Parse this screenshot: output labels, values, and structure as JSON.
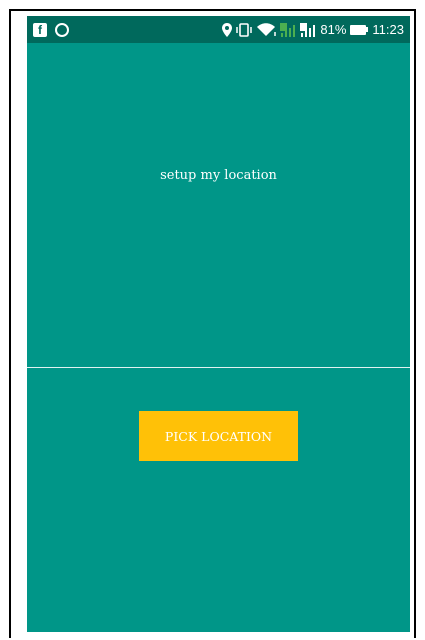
{
  "status_bar": {
    "battery_percent": "81%",
    "time": "11:23",
    "icons": [
      "facebook-icon",
      "whatsapp-icon",
      "location-icon",
      "vibrate-icon",
      "wifi-icon",
      "signal-1-icon",
      "signal-2-icon",
      "battery-icon"
    ]
  },
  "main": {
    "setup_text": "setup my location",
    "pick_button_label": "PICK LOCATION"
  },
  "colors": {
    "background": "#009688",
    "status_bar": "#00695c",
    "button": "#ffc107",
    "text": "#ffffff"
  }
}
